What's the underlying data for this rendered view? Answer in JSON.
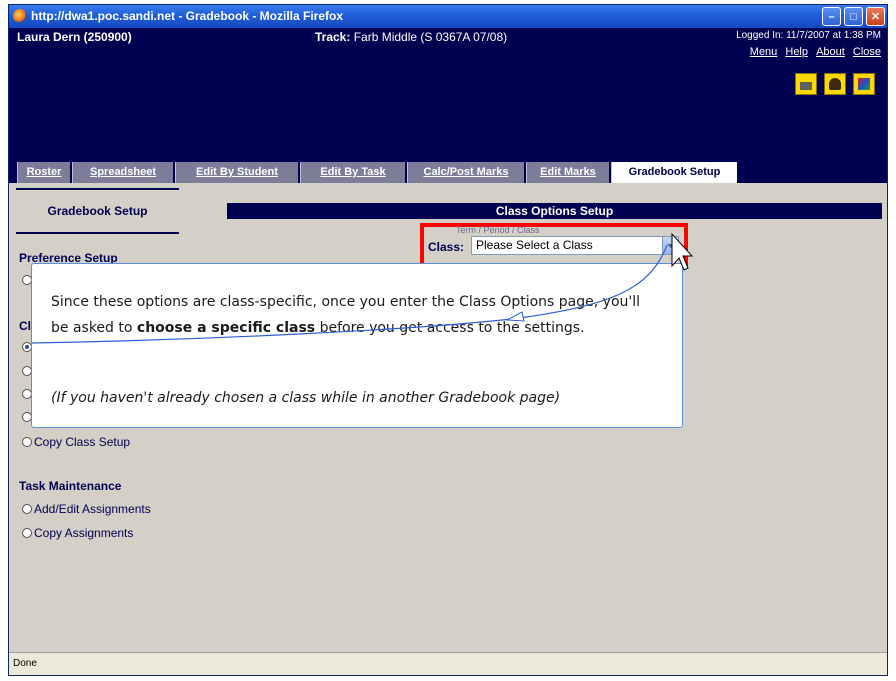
{
  "window": {
    "title": "http://dwa1.poc.sandi.net - Gradebook - Mozilla Firefox"
  },
  "header": {
    "user": "Laura Dern (250900)",
    "track_label": "Track:",
    "track_value": "Farb Middle (S 0367A 07/08)",
    "login": "Logged In: 11/7/2007 at 1:38 PM",
    "links": [
      "Menu",
      "Help",
      "About",
      "Close"
    ],
    "icons": [
      "printer-icon",
      "person-icon",
      "photo-icon"
    ]
  },
  "tabs": [
    "Roster",
    "Spreadsheet",
    "Edit By Student",
    "Edit By Task",
    "Calc/Post Marks",
    "Edit Marks",
    "Gradebook Setup"
  ],
  "left_panel": {
    "title": "Gradebook Setup",
    "preference_section": "Preference Setup",
    "class_section": "Cla",
    "copy_class_setup": "Copy Class Setup",
    "task_section": "Task Maintenance",
    "task_items": [
      "Add/Edit Assignments",
      "Copy Assignments"
    ]
  },
  "main": {
    "bar_title": "Class Options Setup",
    "sub_label": "Term / Period / Class",
    "class_label": "Class:",
    "select_value": "Please Select a Class"
  },
  "callout": {
    "line_a": "Since these options are class-specific, once you enter the Class Options page, you'll be asked to ",
    "line_bold": "choose a specific class",
    "line_c": " before you get access to the settings.",
    "note": "(If you haven't already chosen a class while in another Gradebook page)"
  },
  "status": {
    "text": "Done"
  },
  "colors": {
    "navy": "#000050",
    "highlight": "#ff0000",
    "window_bg": "#d4d0c8",
    "title_blue": "#1f5fd6"
  }
}
